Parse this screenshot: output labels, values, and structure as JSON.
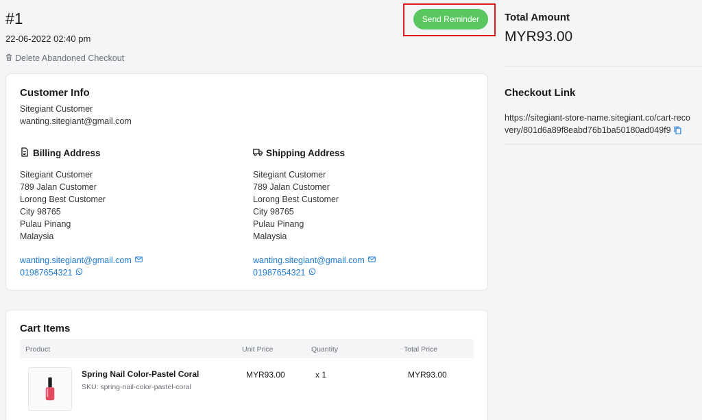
{
  "order": {
    "id": "#1",
    "date": "22-06-2022 02:40 pm",
    "delete_label": "Delete Abandoned Checkout",
    "send_reminder_label": "Send Reminder"
  },
  "customer_info": {
    "title": "Customer Info",
    "name": "Sitegiant Customer",
    "email": "wanting.sitegiant@gmail.com"
  },
  "billing": {
    "title": "Billing Address",
    "lines": [
      "Sitegiant Customer",
      "789 Jalan Customer",
      "Lorong Best Customer",
      "City 98765",
      "Pulau Pinang",
      "Malaysia"
    ],
    "email": "wanting.sitegiant@gmail.com",
    "phone": "01987654321"
  },
  "shipping": {
    "title": "Shipping Address",
    "lines": [
      "Sitegiant Customer",
      "789 Jalan Customer",
      "Lorong Best Customer",
      "City 98765",
      "Pulau Pinang",
      "Malaysia"
    ],
    "email": "wanting.sitegiant@gmail.com",
    "phone": "01987654321"
  },
  "cart": {
    "title": "Cart Items",
    "columns": [
      "Product",
      "Unit Price",
      "Quantity",
      "Total Price"
    ],
    "items": [
      {
        "name": "Spring Nail Color-Pastel Coral",
        "sku": "SKU: spring-nail-color-pastel-coral",
        "unit_price": "MYR93.00",
        "quantity": "x 1",
        "total_price": "MYR93.00"
      }
    ]
  },
  "summary": {
    "total_label": "Total Amount",
    "total_value": "MYR93.00",
    "checkout_link_label": "Checkout Link",
    "checkout_link": "https://sitegiant-store-name.sitegiant.co/cart-recovery/801d6a89f8eabd76b1ba50180ad049f9"
  },
  "colors": {
    "accent_green": "#5ac85f",
    "link_blue": "#1e7bd6",
    "highlight_red": "#e0191b"
  },
  "icons": {
    "delete": "trash-icon",
    "billing": "document-icon",
    "shipping": "truck-icon",
    "email": "envelope-icon",
    "phone": "whatsapp-icon",
    "copy": "copy-icon"
  }
}
